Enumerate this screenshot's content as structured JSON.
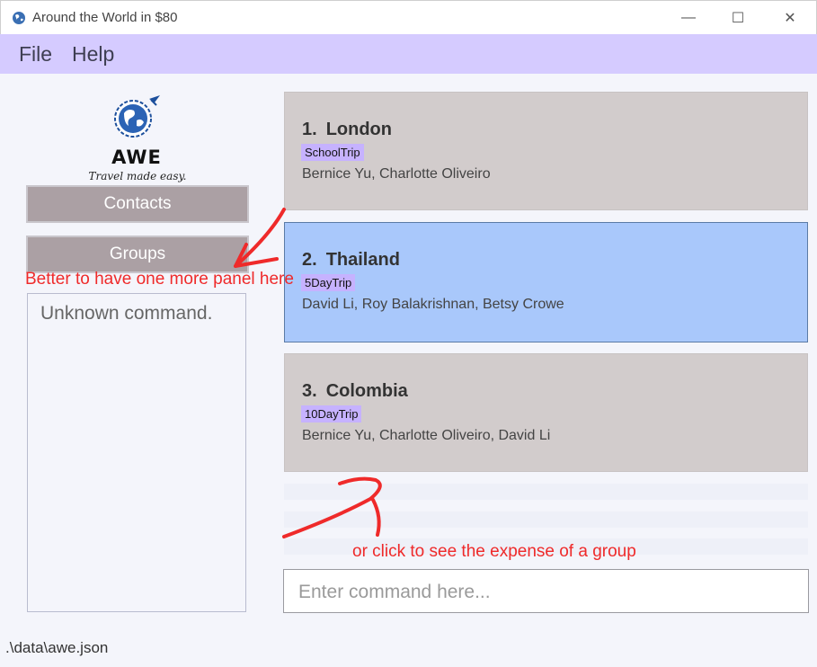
{
  "window": {
    "title": "Around the World in $80",
    "minimize_glyph": "—",
    "maximize_glyph": "☐",
    "close_glyph": "✕"
  },
  "menu": {
    "file": "File",
    "help": "Help"
  },
  "logo": {
    "name": "AWE",
    "tagline": "Travel made easy."
  },
  "sidebar": {
    "contacts_label": "Contacts",
    "groups_label": "Groups",
    "result_text": "Unknown command."
  },
  "groups": [
    {
      "index": "1.",
      "name": "London",
      "tag": "SchoolTrip",
      "members": "Bernice Yu, Charlotte Oliveiro"
    },
    {
      "index": "2.",
      "name": "Thailand",
      "tag": "5DayTrip",
      "members": "David Li, Roy Balakrishnan, Betsy Crowe"
    },
    {
      "index": "3.",
      "name": "Colombia",
      "tag": "10DayTrip",
      "members": "Bernice Yu, Charlotte Oliveiro, David Li"
    }
  ],
  "command": {
    "placeholder": "Enter command here..."
  },
  "status": {
    "file_path": ".\\data\\awe.json"
  },
  "annotations": {
    "panel_note": "Better to have one more panel here",
    "click_note": "or click to see the expense of a group"
  },
  "colors": {
    "menu_bar": "#d5cbff",
    "card": "#d2cccc",
    "card_selected": "#a9c8fb",
    "tag": "#c6b2ff",
    "side_button": "#aba0a4",
    "annotation": "#ef2a2a"
  },
  "icons": {
    "app": "globe-icon",
    "logo": "globe-plane-icon"
  }
}
